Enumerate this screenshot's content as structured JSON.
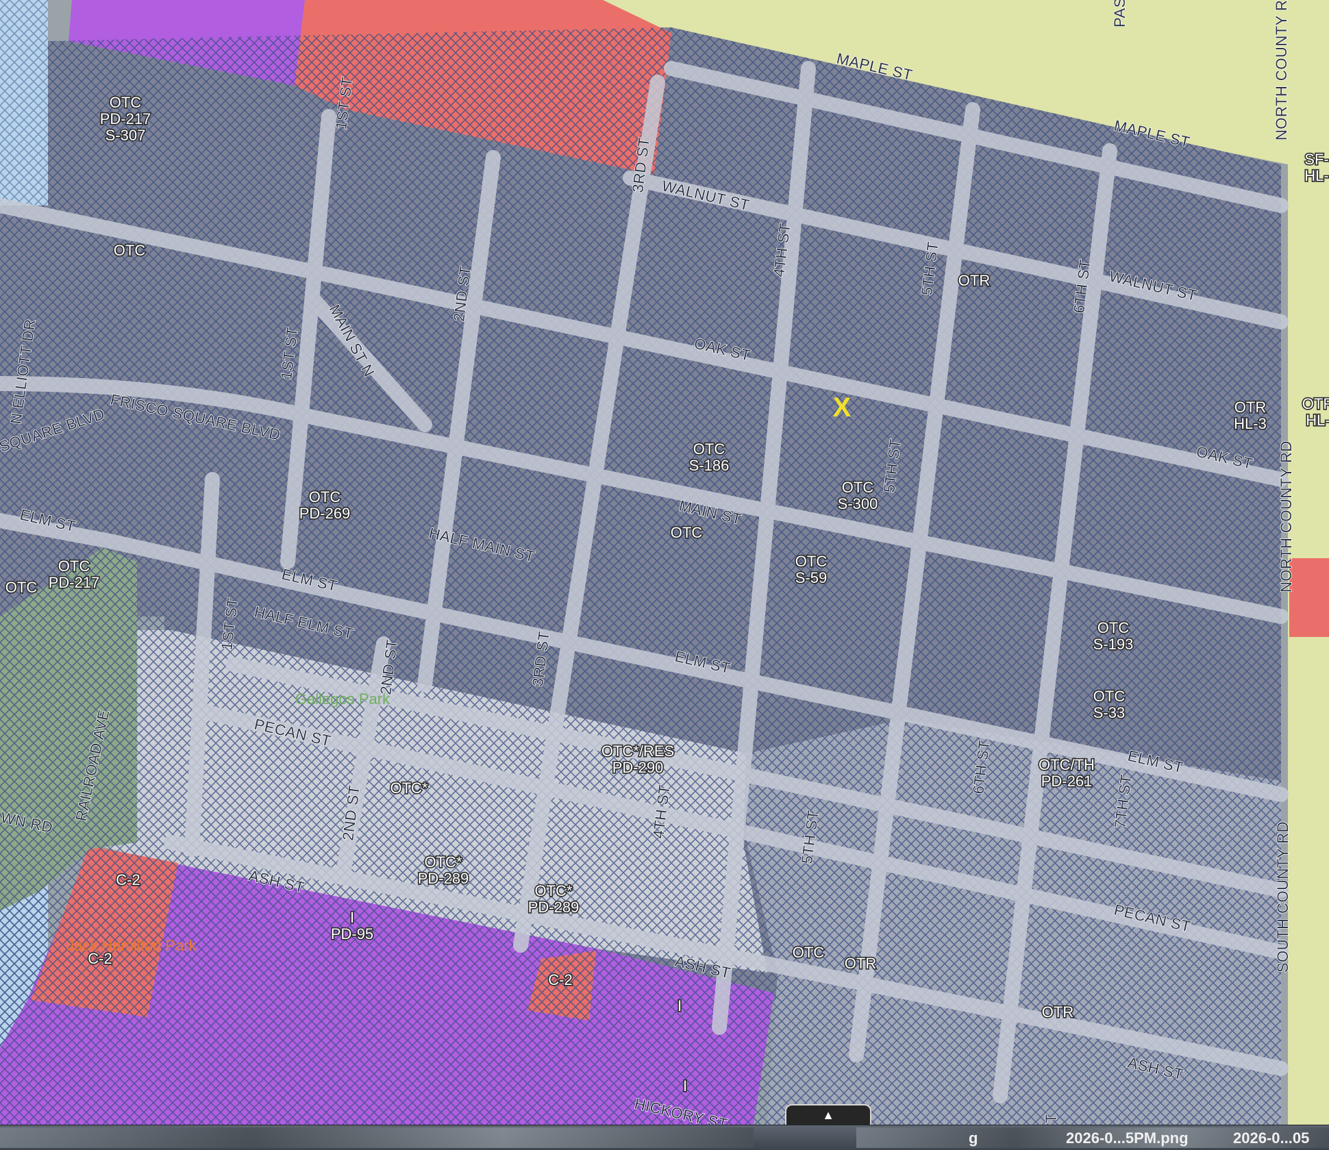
{
  "colors": {
    "otc_district": "#7d8294",
    "res_district": "#cdd0d6",
    "industrial": "#b15ee0",
    "commercial": "#ea6f6a",
    "residential_sf": "#dfe4a8",
    "hatch": "#3a4f85",
    "marker": "#f2e02a"
  },
  "marker": {
    "text": "X"
  },
  "zone_labels": [
    "OTC\nPD-217\nS-307",
    "OTC",
    "OTR",
    "OTR\nHL-3",
    "OTC\nS-186",
    "OTC\nS-300",
    "OTC\nPD-269",
    "OTC",
    "OTC\nS-59",
    "OTC",
    "OTC\nPD-217",
    "OTC\nS-193",
    "OTC\nS-33",
    "OTC*/RES\nPD-290",
    "OTC/TH\nPD-261",
    "OTC*",
    "C-2",
    "OTC*\nPD-289",
    "OTC*\nPD-289",
    "I\nPD-95",
    "C-2",
    "C-2",
    "OTC",
    "OTR",
    "I",
    "OTR",
    "I",
    "SF-\nHL-",
    "OTR\nHL-"
  ],
  "streets": [
    "MAPLE ST",
    "MAPLE ST",
    "WALNUT ST",
    "WALNUT ST",
    "OAK ST",
    "OAK ST",
    "MAIN ST",
    "HALF MAIN ST",
    "ELM ST",
    "ELM ST",
    "ELM ST",
    "ELM ST",
    "HALF ELM ST",
    "PECAN ST",
    "PECAN ST",
    "ASH ST",
    "ASH ST",
    "ASH ST",
    "HICKORY ST",
    "FRISCO SQUARE BLVD",
    "SQUARE BLVD",
    "MAIN ST N",
    "1ST ST",
    "1ST ST",
    "1ST ST",
    "2ND ST",
    "2ND ST",
    "2ND ST",
    "3RD ST",
    "3RD ST",
    "4TH ST",
    "4TH ST",
    "5TH ST",
    "5TH ST",
    "5TH ST",
    "6TH ST",
    "6TH ST",
    "7TH ST",
    "NORTH COUNTY R",
    "NORTH COUNTY RD",
    "SOUTH COUNTY RD",
    "RAILROAD AVE",
    "N ELLIOTT DR",
    "WN RD",
    "PAS",
    "T"
  ],
  "parks": [
    "Gallegos Park",
    "Jack Hamilton Park"
  ],
  "taskbar": {
    "items": [
      "g",
      "2026-0...5PM.png",
      "2026-0...05"
    ]
  },
  "collapse": {
    "icon": "▲"
  }
}
